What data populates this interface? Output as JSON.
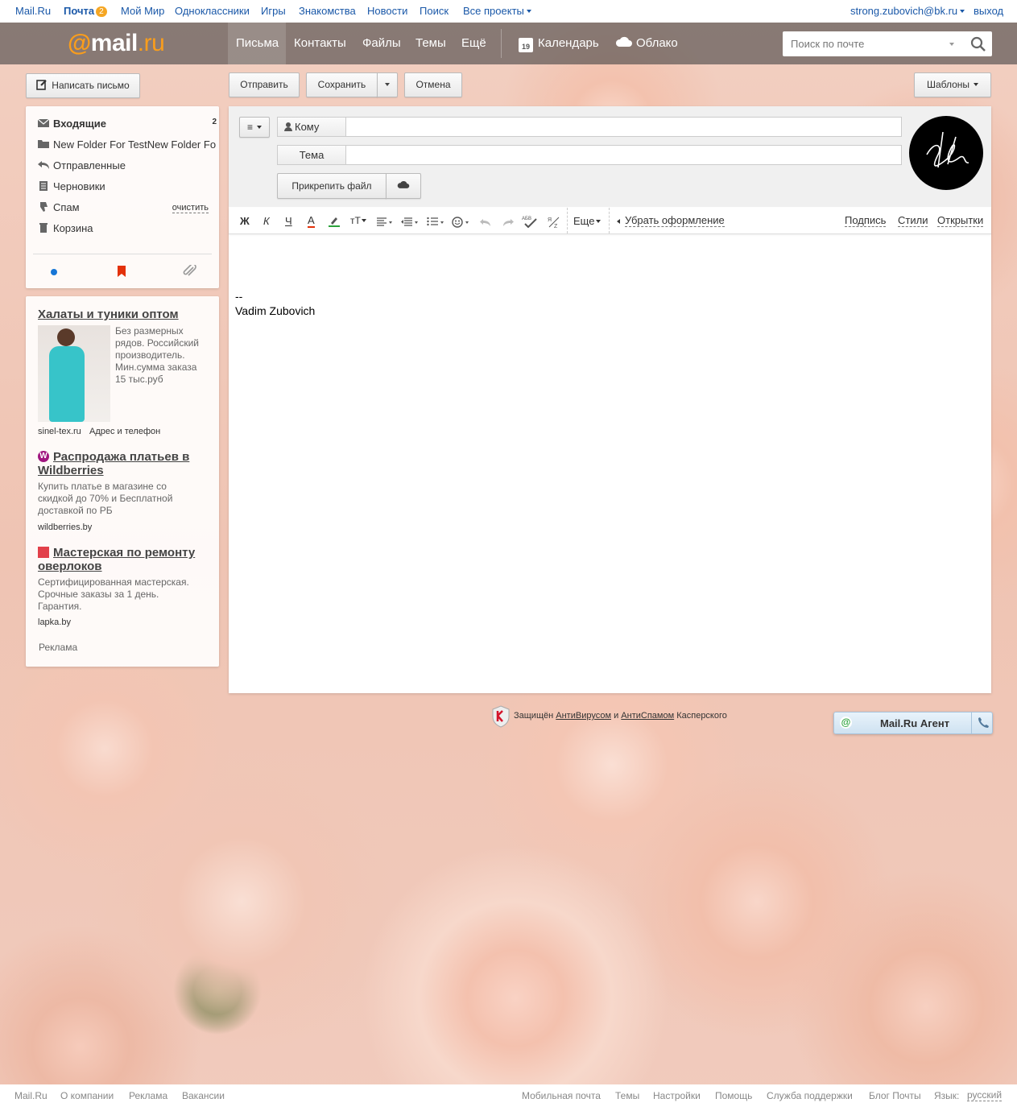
{
  "portal": {
    "mailru": "Mail.Ru",
    "pochta": "Почта",
    "pochta_count": "2",
    "moimir": "Мой Мир",
    "ok": "Одноклассники",
    "games": "Игры",
    "dating": "Знакомства",
    "news": "Новости",
    "search": "Поиск",
    "all": "Все проекты",
    "user": "strong.zubovich@bk.ru",
    "logout": "выход"
  },
  "header": {
    "logo_at": "@",
    "logo_mail": "mail",
    "logo_ru": ".ru",
    "nav": [
      "Письма",
      "Контакты",
      "Файлы",
      "Темы",
      "Ещё"
    ],
    "calendar": "Календарь",
    "calendar_day": "19",
    "cloud": "Облако",
    "search_placeholder": "Поиск по почте"
  },
  "actions": {
    "compose": "Написать письмо",
    "send": "Отправить",
    "save": "Сохранить",
    "cancel": "Отмена",
    "templates": "Шаблоны"
  },
  "folders": [
    {
      "name": "Входящие",
      "count": "2"
    },
    {
      "name": "New Folder For TestNew Folder Fo"
    },
    {
      "name": "Отправленные"
    },
    {
      "name": "Черновики"
    },
    {
      "name": "Спам",
      "action": "очистить"
    },
    {
      "name": "Корзина"
    }
  ],
  "ads": [
    {
      "title": "Халаты и туники оптом",
      "text": "Без размерных рядов. Российский производитель. Мин.сумма заказа 15 тыс.руб",
      "domain": "sinel-tex.ru",
      "extra": "Адрес и телефон"
    },
    {
      "title": "Распродажа платьев в Wildberries",
      "text": "Купить платье в магазине со скидкой до 70% и Бесплатной доставкой по РБ",
      "domain": "wildberries.by"
    },
    {
      "title": "Мастерская по ремонту оверлоков",
      "text": "Сертифицированная мастерская. Срочные заказы за 1 день. Гарантия.",
      "domain": "lapka.by"
    }
  ],
  "ads_label": "Реклама",
  "compose": {
    "to_label": "Кому",
    "subject_label": "Тема",
    "attach": "Прикрепить файл",
    "toolbar": {
      "bold": "Ж",
      "italic": "К",
      "underline": "Ч",
      "color": "A",
      "size": "тТ",
      "more": "Еще",
      "clear": "Убрать оформление",
      "signature": "Подпись",
      "styles": "Стили",
      "cards": "Открытки"
    },
    "sig_dash": "--",
    "sig_name": "Vadim Zubovich"
  },
  "kaspersky": {
    "prefix": "Защищён",
    "antivirus": "АнтиВирусом",
    "and": "и",
    "antispam": "АнтиСпамом",
    "suffix": "Касперского"
  },
  "agent": "Mail.Ru Агент",
  "footer": {
    "left": [
      "Mail.Ru",
      "О компании",
      "Реклама",
      "Вакансии"
    ],
    "right": [
      "Мобильная почта",
      "Темы",
      "Настройки",
      "Помощь",
      "Служба поддержки",
      "Блог Почты"
    ],
    "lang_label": "Язык:",
    "lang": "русский"
  },
  "colors": {
    "accent": "#f99d1c",
    "link": "#1a58a8",
    "badge": "#f5a623"
  }
}
